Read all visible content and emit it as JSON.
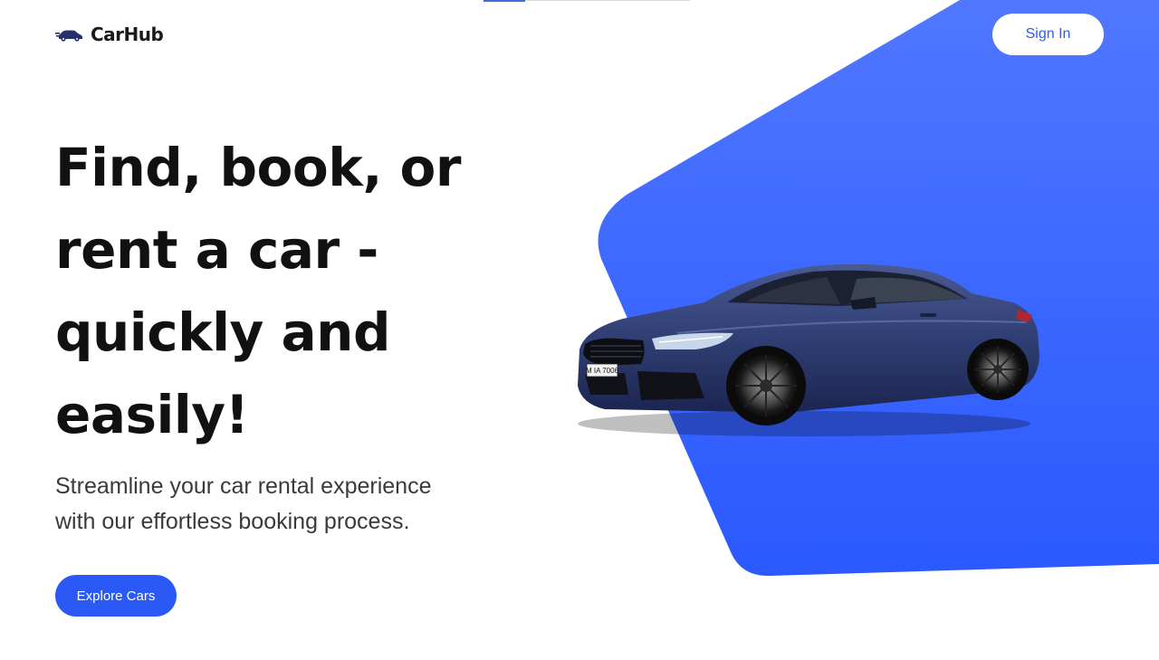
{
  "brand": {
    "name": "CarHub",
    "icon": "car-logo-icon"
  },
  "nav": {
    "sign_in_label": "Sign In"
  },
  "hero": {
    "title_lines": [
      "Find, book, or",
      "rent a car -",
      "quickly and",
      "easily!"
    ],
    "subtitle_lines": [
      "Streamline your car rental experience",
      "with our effortless booking process."
    ],
    "cta_label": "Explore Cars"
  },
  "car_image": {
    "plate_text": "M IA 7006",
    "icon": "car-image"
  },
  "colors": {
    "accent": "#2b59f5",
    "shape_light": "#4d74ff",
    "shape_dark": "#2a59fe",
    "car_body": "#2f3f74"
  }
}
